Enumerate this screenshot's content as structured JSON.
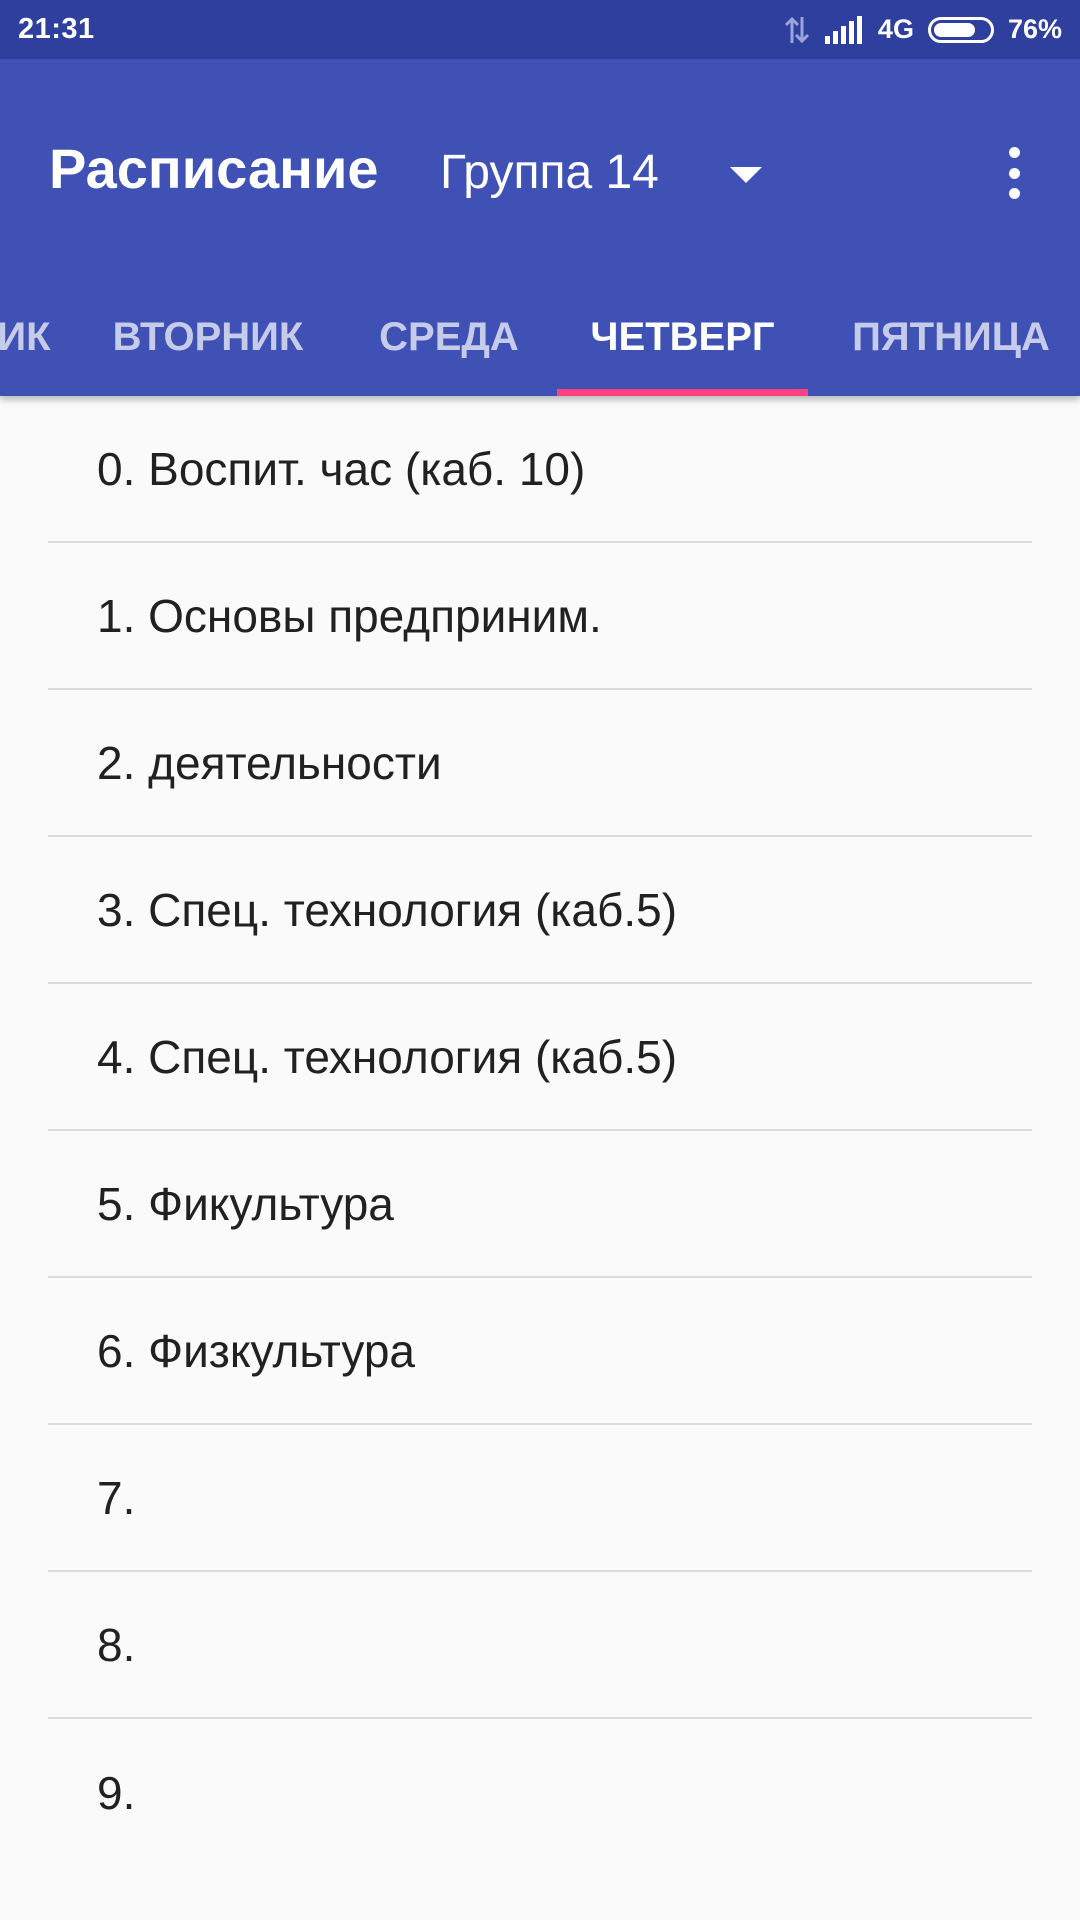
{
  "status_bar": {
    "time": "21:31",
    "network": "4G",
    "battery_percent_label": "76%",
    "battery_level": 0.76
  },
  "app_bar": {
    "title": "Расписание",
    "group_selector": "Группа 14",
    "icons": {
      "dropdown": "chevron-down-icon",
      "menu": "more-vert-icon"
    }
  },
  "tabs": [
    {
      "label": "ИК",
      "active": false
    },
    {
      "label": "ВТОРНИК",
      "active": false
    },
    {
      "label": "СРЕДА",
      "active": false
    },
    {
      "label": "ЧЕТВЕРГ",
      "active": true
    },
    {
      "label": "ПЯТНИЦА",
      "active": false
    }
  ],
  "lessons": [
    "0. Воспит. час (каб. 10)",
    "1. Основы предприним.",
    "2. деятельности",
    "3. Спец. технология (каб.5)",
    "4. Спец. технология (каб.5)",
    "5. Фикультура",
    "6. Физкультура",
    "7.",
    "8.",
    "9."
  ],
  "colors": {
    "primary": "#3f51b5",
    "status_bar": "#2f3f9e",
    "accent": "#ff4081",
    "background": "#fafafa",
    "divider": "#dcdcdc",
    "text": "#212121"
  }
}
